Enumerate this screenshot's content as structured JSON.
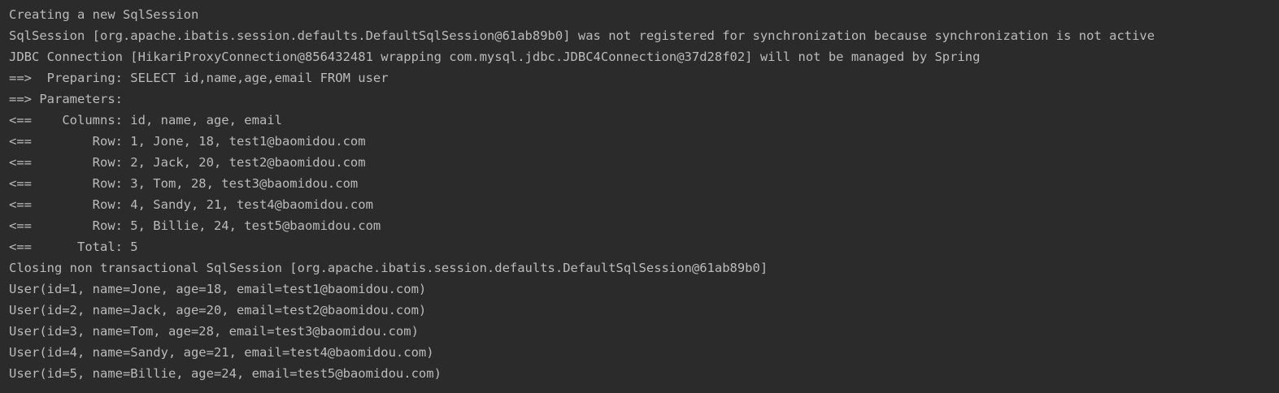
{
  "console": {
    "lines": [
      "Creating a new SqlSession",
      "SqlSession [org.apache.ibatis.session.defaults.DefaultSqlSession@61ab89b0] was not registered for synchronization because synchronization is not active",
      "JDBC Connection [HikariProxyConnection@856432481 wrapping com.mysql.jdbc.JDBC4Connection@37d28f02] will not be managed by Spring",
      "==>  Preparing: SELECT id,name,age,email FROM user",
      "==> Parameters: ",
      "<==    Columns: id, name, age, email",
      "<==        Row: 1, Jone, 18, test1@baomidou.com",
      "<==        Row: 2, Jack, 20, test2@baomidou.com",
      "<==        Row: 3, Tom, 28, test3@baomidou.com",
      "<==        Row: 4, Sandy, 21, test4@baomidou.com",
      "<==        Row: 5, Billie, 24, test5@baomidou.com",
      "<==      Total: 5",
      "Closing non transactional SqlSession [org.apache.ibatis.session.defaults.DefaultSqlSession@61ab89b0]",
      "User(id=1, name=Jone, age=18, email=test1@baomidou.com)",
      "User(id=2, name=Jack, age=20, email=test2@baomidou.com)",
      "User(id=3, name=Tom, age=28, email=test3@baomidou.com)",
      "User(id=4, name=Sandy, age=21, email=test4@baomidou.com)",
      "User(id=5, name=Billie, age=24, email=test5@baomidou.com)"
    ]
  },
  "colors": {
    "background": "#2b2b2b",
    "text": "#bbbbbb"
  }
}
